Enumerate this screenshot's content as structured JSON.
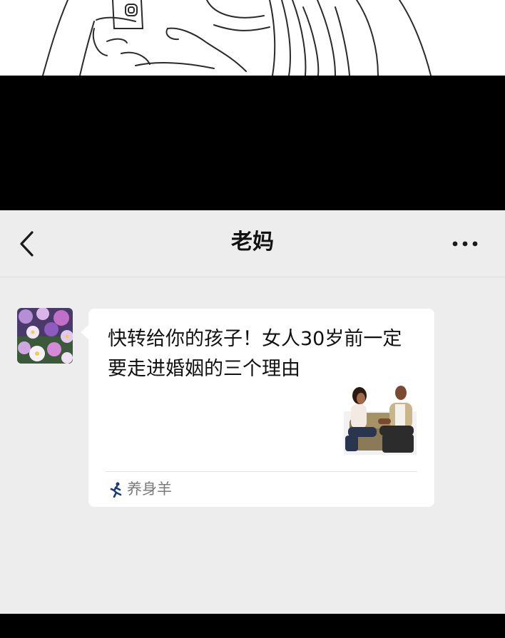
{
  "chat": {
    "title": "老妈",
    "back_icon": "chevron-left-icon",
    "more_icon": "more-dots-icon"
  },
  "message": {
    "sender_avatar": "flower-avatar",
    "article_title": "快转给你的孩子！女人30岁前一定要走进婚姻的三个理由",
    "thumbnail": "couple-on-sofa-photo",
    "source_icon": "running-figure-icon",
    "source_name": "养身羊"
  },
  "colors": {
    "chat_background": "#ededed",
    "bubble": "#ffffff",
    "band": "#000000"
  }
}
